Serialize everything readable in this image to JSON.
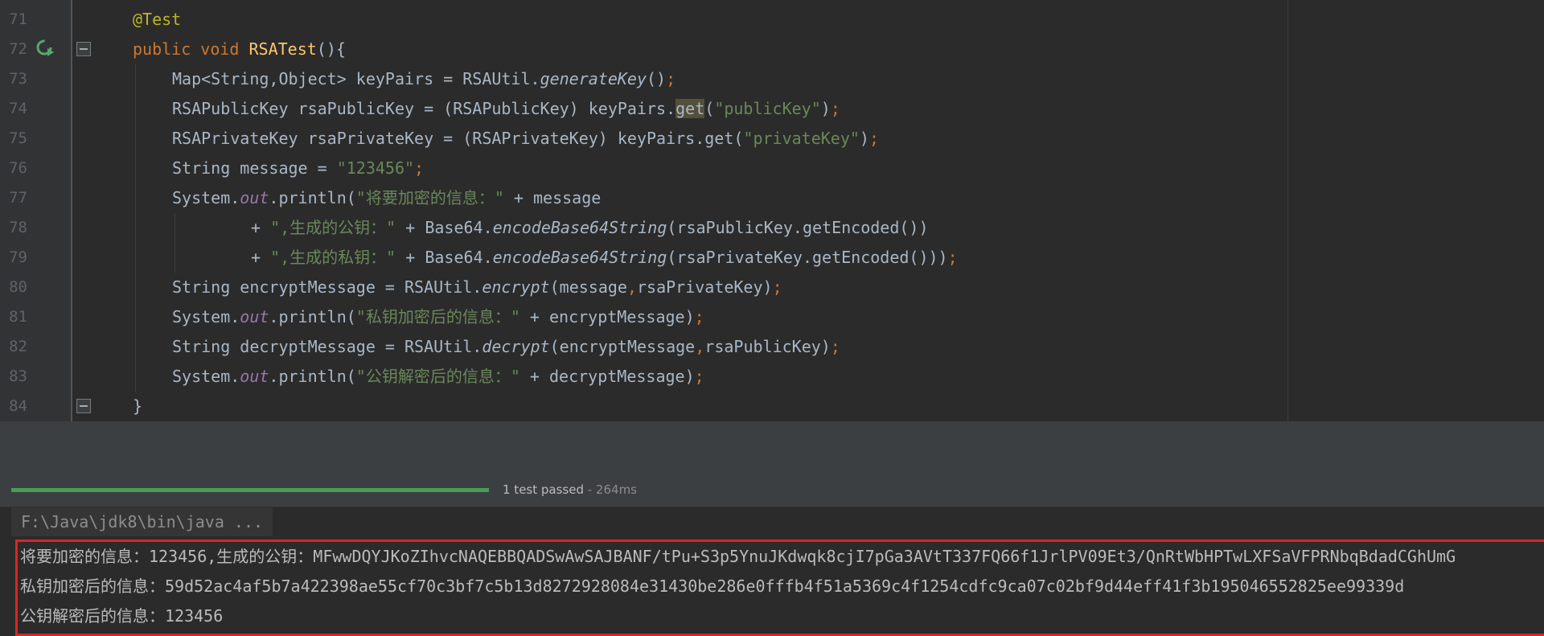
{
  "editor": {
    "line_numbers": [
      "71",
      "72",
      "73",
      "74",
      "75",
      "76",
      "77",
      "78",
      "79",
      "80",
      "81",
      "82",
      "83",
      "84"
    ],
    "lines": {
      "l71": {
        "annotation": "@Test"
      },
      "l72": {
        "kw1": "public",
        "kw2": "void",
        "method": "RSATest",
        "rest": "(){"
      },
      "l73": {
        "a": "Map<String,Object> keyPairs = RSAUtil.",
        "m": "generateKey",
        "b": "()",
        "semi": ";"
      },
      "l74": {
        "a": "RSAPublicKey rsaPublicKey = (RSAPublicKey) keyPairs.",
        "get": "get",
        "b": "(",
        "s": "\"publicKey\"",
        "c": ")",
        "semi": ";"
      },
      "l75": {
        "a": "RSAPrivateKey rsaPrivateKey = (RSAPrivateKey) keyPairs.get(",
        "s": "\"privateKey\"",
        "c": ")",
        "semi": ";"
      },
      "l76": {
        "a": "String message = ",
        "s": "\"123456\"",
        "semi": ";"
      },
      "l77": {
        "a": "System.",
        "out": "out",
        "b": ".println(",
        "s": "\"将要加密的信息：\"",
        "c": " + message"
      },
      "l78": {
        "a": "+ ",
        "s": "\",生成的公钥：\"",
        "b": " + Base64.",
        "m": "encodeBase64String",
        "c": "(rsaPublicKey.getEncoded())"
      },
      "l79": {
        "a": "+ ",
        "s": "\",生成的私钥：\"",
        "b": " + Base64.",
        "m": "encodeBase64String",
        "c": "(rsaPrivateKey.getEncoded()))",
        "semi": ";"
      },
      "l80": {
        "a": "String encryptMessage = RSAUtil.",
        "m": "encrypt",
        "b": "(message",
        "comma": ",",
        "c": "rsaPrivateKey)",
        "semi": ";"
      },
      "l81": {
        "a": "System.",
        "out": "out",
        "b": ".println(",
        "s": "\"私钥加密后的信息：\"",
        "c": " + encryptMessage)",
        "semi": ";"
      },
      "l82": {
        "a": "String decryptMessage = RSAUtil.",
        "m": "decrypt",
        "b": "(encryptMessage",
        "comma": ",",
        "c": "rsaPublicKey)",
        "semi": ";"
      },
      "l83": {
        "a": "System.",
        "out": "out",
        "b": ".println(",
        "s": "\"公钥解密后的信息：\"",
        "c": " + decryptMessage)",
        "semi": ";"
      },
      "l84": {
        "a": "}"
      }
    }
  },
  "test_run": {
    "progress": 1.0,
    "status": "1 test passed",
    "time": " - 264ms"
  },
  "console": {
    "command": "F:\\Java\\jdk8\\bin\\java ...",
    "output": [
      "将要加密的信息：123456,生成的公钥：MFwwDQYJKoZIhvcNAQEBBQADSwAwSAJBANF/tPu+S3p5YnuJKdwqk8cjI7pGa3AVtT337FQ66f1JrlPV09Et3/QnRtWbHPTwLXFSaVFPRNbqBdadCGhUmG",
      "私钥加密后的信息：59d52ac4af5b7a422398ae55cf70c3bf7c5b13d8272928084e31430be286e0fffb4f51a5369c4f1254cdfc9ca07c02bf9d44eff41f3b195046552825ee99339d",
      "公钥解密后的信息：123456"
    ]
  },
  "colors": {
    "background": "#2b2b2b",
    "keyword": "#cc7832",
    "string": "#6a8759",
    "method_decl": "#ffc66d",
    "annotation": "#bbb529",
    "static_field": "#9876aa",
    "progress_pass": "#499c54",
    "output_highlight_border": "#d6252a"
  }
}
